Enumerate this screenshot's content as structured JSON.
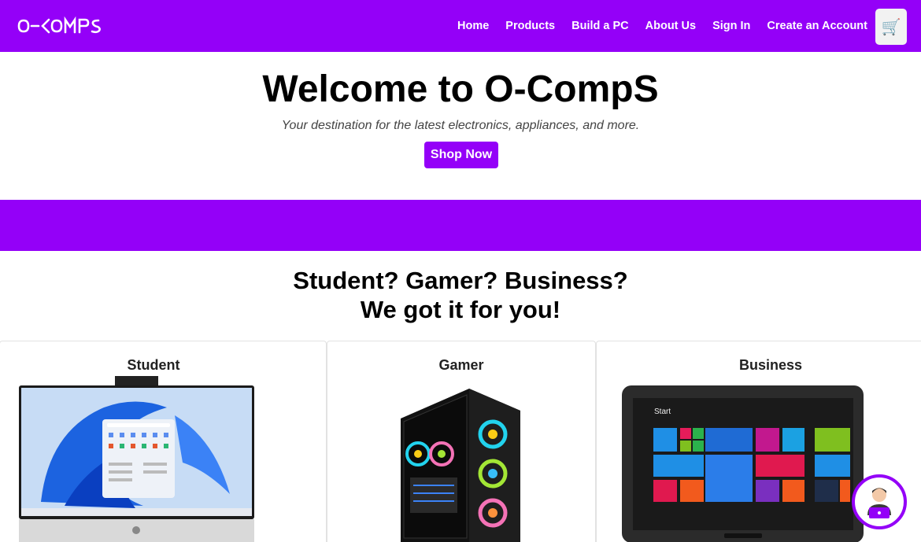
{
  "brand": {
    "logo_text": "O-COMPS",
    "accent": "#9400f8"
  },
  "nav": {
    "links": [
      "Home",
      "Products",
      "Build a PC",
      "About Us",
      "Sign In",
      "Create an Account"
    ],
    "cart_icon": "cart-icon"
  },
  "hero": {
    "title": "Welcome to O-CompS",
    "subtitle": "Your destination for the latest electronics, appliances, and more.",
    "cta": "Shop Now"
  },
  "tagline": {
    "line1": "Student? Gamer? Business?",
    "line2": "We got it for you!"
  },
  "categories": [
    {
      "label": "Student",
      "image": "all-in-one-pc"
    },
    {
      "label": "Gamer",
      "image": "gaming-tower"
    },
    {
      "label": "Business",
      "image": "windows-tablet"
    }
  ],
  "chat": {
    "icon": "support-agent-icon"
  }
}
